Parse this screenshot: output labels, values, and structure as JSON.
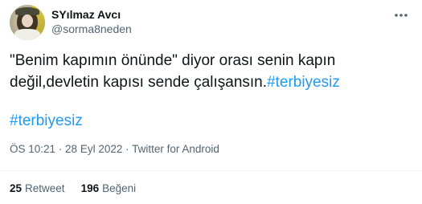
{
  "author": {
    "display_name": "SYılmaz Avcı",
    "handle": "@sorma8neden"
  },
  "tweet": {
    "text_line1": "\"Benim kapımın önünde\" diyor orası senin kapın",
    "text_line2": "değil,devletin kapısı sende çalışansın.",
    "inline_hashtag": "#terbiyesiz",
    "hashtag": "#terbiyesiz"
  },
  "meta": {
    "time": "ÖS 10:21",
    "separator": " · ",
    "date": "28 Eyl 2022",
    "source": "Twitter for Android"
  },
  "stats": {
    "retweets_count": "25",
    "retweets_label": "Retweet",
    "likes_count": "196",
    "likes_label": "Beğeni"
  },
  "colors": {
    "hashtag": "#1d9bf0",
    "secondary_text": "#536471",
    "primary_text": "#0f1419"
  },
  "icons": {
    "more": "more-horizontal-icon"
  }
}
